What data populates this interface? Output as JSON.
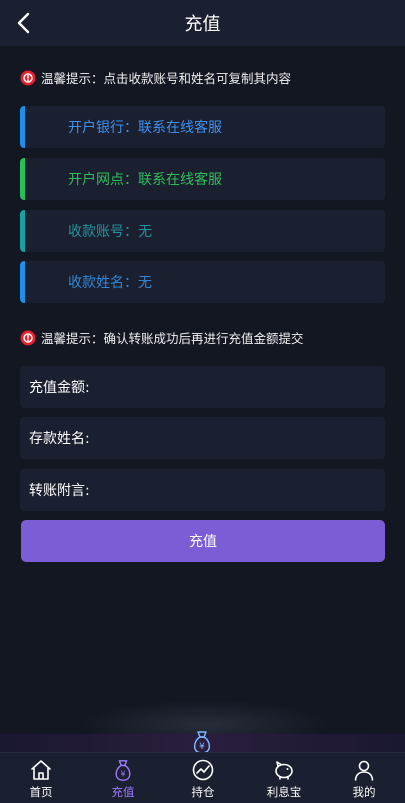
{
  "header": {
    "title": "充值"
  },
  "tips": {
    "copy_hint": "温馨提示：点击收款账号和姓名可复制其内容",
    "confirm_hint": "温馨提示：确认转账成功后再进行充值金额提交"
  },
  "account_info": [
    {
      "text": "开户银行：联系在线客服",
      "color": "#3d8ff0",
      "bar": "#1e8fe8"
    },
    {
      "text": "开户网点：联系在线客服",
      "color": "#2fbe5a",
      "bar": "#27c159"
    },
    {
      "text": "收款账号：无",
      "color": "#22949b",
      "bar": "#18a0a4"
    },
    {
      "text": "收款姓名：无",
      "color": "#2f86d6",
      "bar": "#1e8fe8"
    }
  ],
  "form": {
    "amount_label": "充值金额:",
    "amount_value": "",
    "name_label": "存款姓名:",
    "name_value": "",
    "note_label": "转账附言:",
    "note_value": "",
    "submit_label": "充值"
  },
  "nav": {
    "items": [
      {
        "label": "首页",
        "icon": "home-icon"
      },
      {
        "label": "充值",
        "icon": "money-bag-icon"
      },
      {
        "label": "持仓",
        "icon": "trend-chart-icon"
      },
      {
        "label": "利息宝",
        "icon": "piggy-bank-icon"
      },
      {
        "label": "我的",
        "icon": "user-icon"
      }
    ],
    "active_index": 1,
    "active_color": "#9d7bff"
  },
  "colors": {
    "background": "#121722",
    "panel": "#1b2030",
    "accent": "#7b5ed6",
    "tip_icon": "#e8202a"
  }
}
